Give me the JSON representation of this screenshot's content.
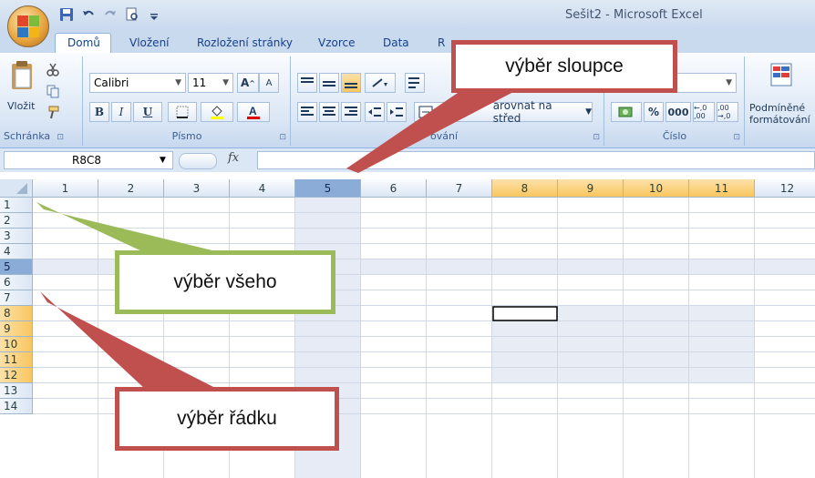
{
  "window": {
    "title": "Sešit2 - Microsoft Excel"
  },
  "tabs": [
    {
      "label": "Domů",
      "active": true
    },
    {
      "label": "Vložení",
      "active": false
    },
    {
      "label": "Rozložení stránky",
      "active": false
    },
    {
      "label": "Vzorce",
      "active": false
    },
    {
      "label": "Data",
      "active": false
    },
    {
      "label": "R",
      "active": false
    }
  ],
  "ribbon": {
    "clipboard": {
      "label": "Schránka",
      "paste_label": "Vložit"
    },
    "font": {
      "label": "Písmo",
      "font_name": "Calibri",
      "font_size": "11",
      "bold": "B",
      "italic": "I",
      "underline": "U",
      "grow": "A",
      "shrink": "A"
    },
    "alignment": {
      "label": "ování",
      "merge_label": "arovnat na střed"
    },
    "number": {
      "label": "Číslo",
      "percent": "%",
      "thousands": "000",
      "inc_decimal": "←,0 ,00",
      "dec_decimal": ",00 →,0"
    },
    "styles": {
      "cond_format_line1": "Podmíněné",
      "cond_format_line2": "formátování"
    }
  },
  "formula_bar": {
    "name_box": "R8C8",
    "fx": "fx",
    "value": ""
  },
  "sheet": {
    "columns": [
      "1",
      "2",
      "3",
      "4",
      "5",
      "6",
      "7",
      "8",
      "9",
      "10",
      "11",
      "12"
    ],
    "rows": [
      "1",
      "2",
      "3",
      "4",
      "5",
      "6",
      "7",
      "8",
      "9",
      "10",
      "11",
      "12",
      "13",
      "14"
    ],
    "selected_column": "5",
    "selected_row": "5",
    "active_cell": "R8C8"
  },
  "callouts": {
    "column_selection": "výběr sloupce",
    "select_all": "výběr všeho",
    "row_selection": "výběr řádku"
  },
  "colors": {
    "ribbon_blue": "#c9d9ee",
    "column_callout": "#c0504d",
    "select_all_callout": "#9bbb59",
    "row_callout": "#c0504d",
    "header_highlight": "#f9c65f",
    "selection_fill": "#e8ecf5"
  }
}
